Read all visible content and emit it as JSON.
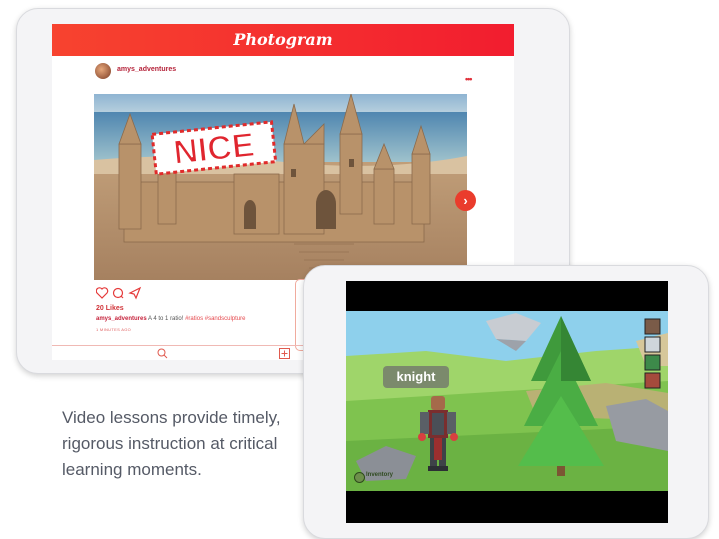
{
  "photogram": {
    "app_title": "Photogram",
    "username": "amys_adventures",
    "photo_text": "NICE",
    "likes": "20 Likes",
    "caption_user": "amys_adventures",
    "caption_text": "A 4 to 1 ratio!",
    "caption_tags": "#ratios #sandsculpture",
    "time": "1 MINUTES AGO"
  },
  "game": {
    "character_label": "knight",
    "inventory_label": "Inventory"
  },
  "description": "Video lessons provide timely, rigorous instruction at critical learning moments.",
  "colors": {
    "photogram_header": "#f4312e",
    "accent_red": "#ea3c2c",
    "description_text": "#555a66"
  }
}
